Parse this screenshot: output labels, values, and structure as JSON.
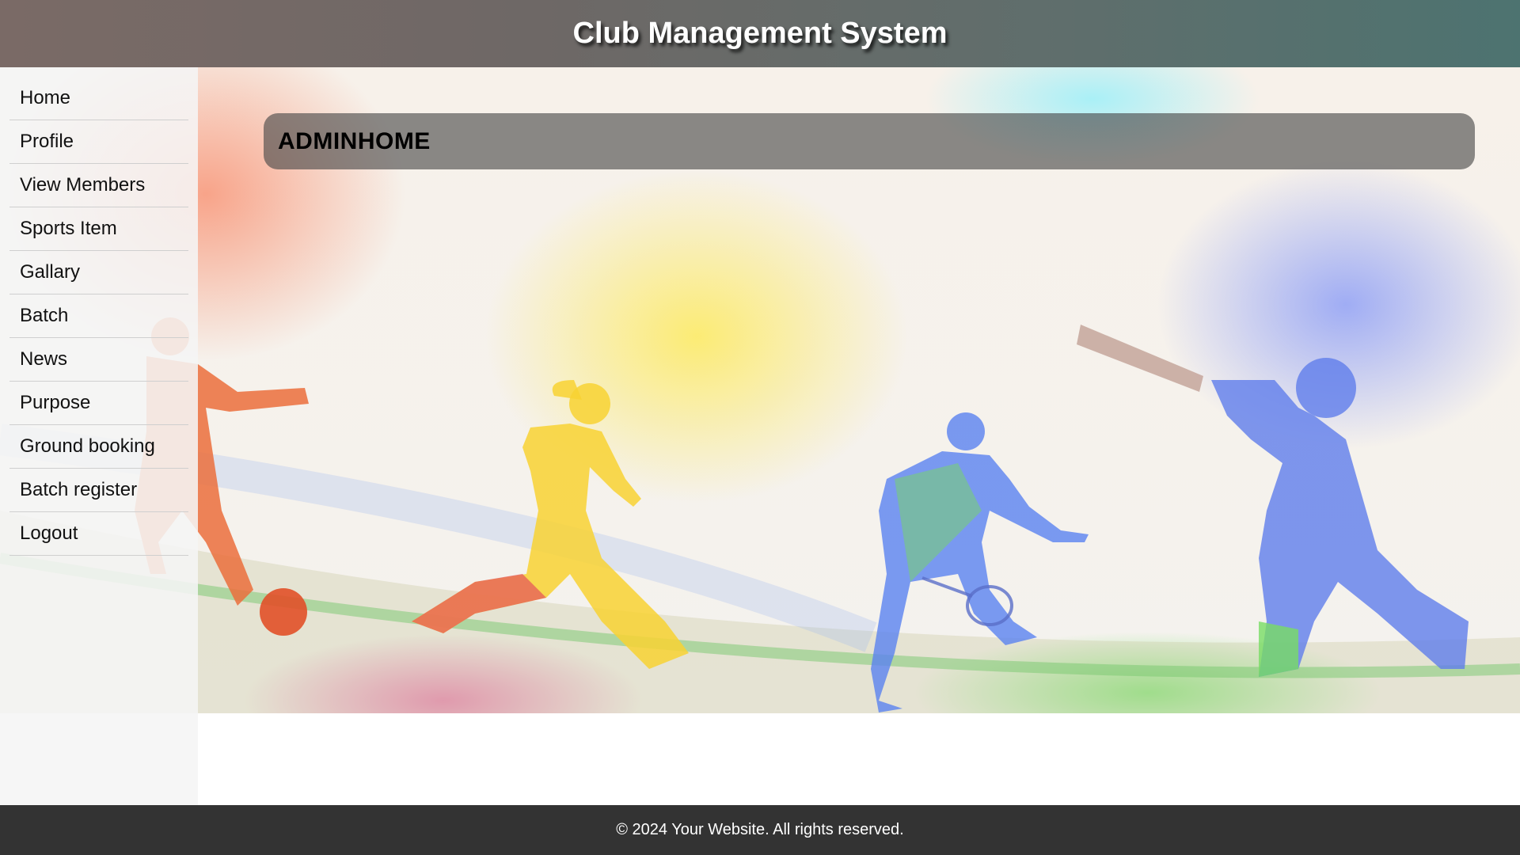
{
  "header": {
    "title": "Club Management System"
  },
  "sidebar": {
    "items": [
      {
        "label": "Home"
      },
      {
        "label": "Profile"
      },
      {
        "label": "View Members"
      },
      {
        "label": "Sports Item"
      },
      {
        "label": "Gallary"
      },
      {
        "label": "Batch"
      },
      {
        "label": "News"
      },
      {
        "label": "Purpose"
      },
      {
        "label": "Ground booking"
      },
      {
        "label": "Batch register"
      },
      {
        "label": "Logout"
      }
    ]
  },
  "main": {
    "page_title": "ADMINHOME"
  },
  "footer": {
    "text": "© 2024 Your Website. All rights reserved."
  },
  "colors": {
    "header_bg": "#6e6866",
    "footer_bg": "#333333",
    "sidebar_bg": "#f5f5f5",
    "title_bar_bg": "#4a4a4a"
  }
}
